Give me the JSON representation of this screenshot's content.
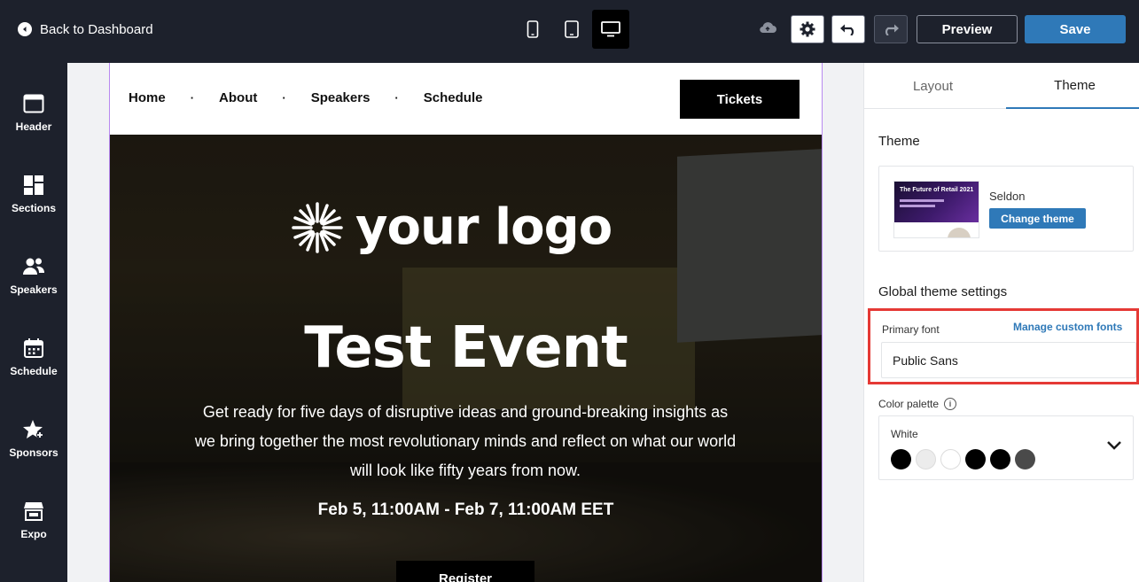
{
  "topbar": {
    "back_label": "Back to Dashboard",
    "preview_label": "Preview",
    "save_label": "Save"
  },
  "sidebar": {
    "items": [
      {
        "label": "Header",
        "icon": "header-icon"
      },
      {
        "label": "Sections",
        "icon": "sections-icon"
      },
      {
        "label": "Speakers",
        "icon": "speakers-icon"
      },
      {
        "label": "Schedule",
        "icon": "schedule-icon"
      },
      {
        "label": "Sponsors",
        "icon": "sponsors-icon"
      },
      {
        "label": "Expo",
        "icon": "expo-icon"
      }
    ]
  },
  "page": {
    "nav": [
      "Home",
      "About",
      "Speakers",
      "Schedule"
    ],
    "separator": "·",
    "tickets_label": "Tickets",
    "logo_text": "your logo",
    "title": "Test Event",
    "description": "Get ready for five days of disruptive ideas and ground-breaking insights as we bring together the most revolutionary minds and reflect on what our world will look like fifty years from now.",
    "date": "Feb 5, 11:00AM - Feb 7, 11:00AM EET",
    "register_label": "Register"
  },
  "panel": {
    "tabs": [
      "Layout",
      "Theme"
    ],
    "active_tab": "Theme",
    "theme_heading": "Theme",
    "theme_thumb_title": "The Future of Retail 2021",
    "theme_name": "Seldon",
    "change_theme_label": "Change theme",
    "global_heading": "Global theme settings",
    "primary_font_label": "Primary font",
    "manage_fonts_label": "Manage custom fonts",
    "primary_font_value": "Public Sans",
    "palette_label": "Color palette",
    "palette_name": "White",
    "palette_colors": [
      "#000000",
      "#ececec",
      "#ffffff",
      "#000000",
      "#000000",
      "#4a4a4a"
    ]
  },
  "colors": {
    "accent": "#2f79b8",
    "highlight": "#e53935",
    "dark_bg": "#1d212c"
  }
}
